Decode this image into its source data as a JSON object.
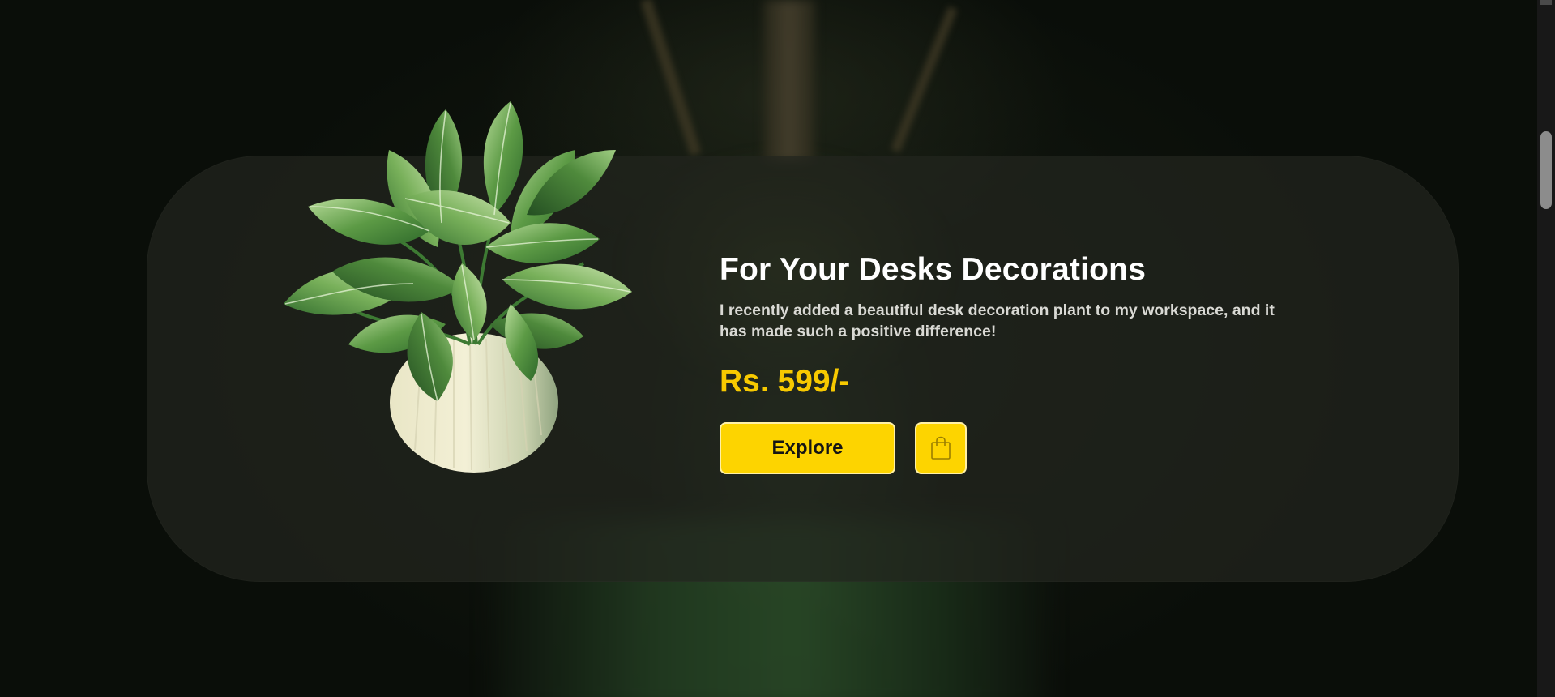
{
  "hero": {
    "title": "For Your Desks Decorations",
    "description": "I recently added a beautiful desk decoration plant to my workspace, and it has made such a positive difference!",
    "price": "Rs. 599/-",
    "explore_label": "Explore",
    "cart_icon": "shopping-bag-icon",
    "product_image": "potted-plant-image"
  },
  "colors": {
    "accent": "#fdd400",
    "price": "#f7c900",
    "background": "#0c110b",
    "card": "#22261e"
  }
}
